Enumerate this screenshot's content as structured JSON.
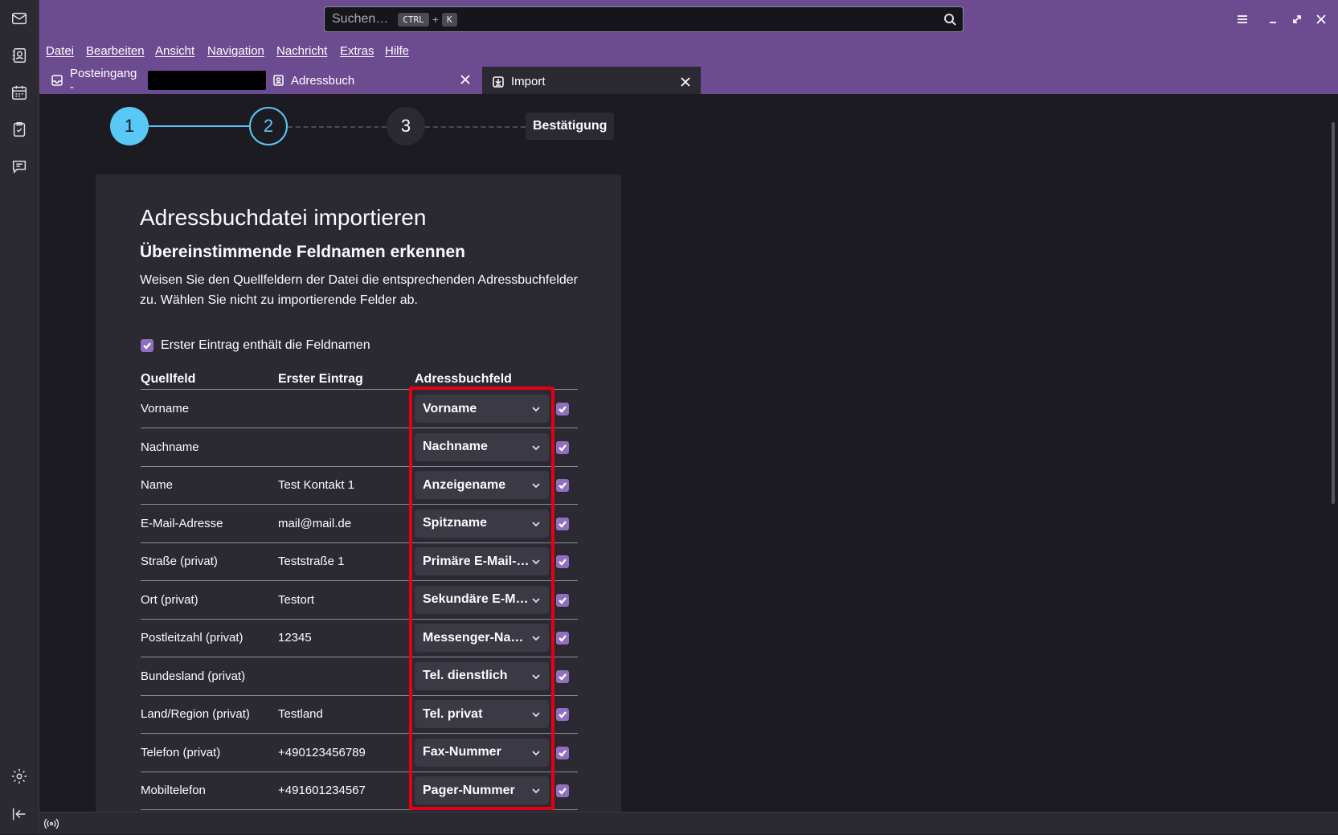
{
  "search": {
    "placeholder": "Suchen…",
    "key1": "CTRL",
    "plus": "+",
    "key2": "K"
  },
  "menu": [
    "Datei",
    "Bearbeiten",
    "Ansicht",
    "Navigation",
    "Nachricht",
    "Extras",
    "Hilfe"
  ],
  "tabs": [
    {
      "label": "Posteingang -"
    },
    {
      "label": "Adressbuch"
    },
    {
      "label": "Import"
    }
  ],
  "stepper": {
    "step1": "1",
    "step2": "2",
    "step3": "3",
    "confirm": "Bestätigung"
  },
  "page": {
    "title": "Adressbuchdatei importieren",
    "subtitle": "Übereinstimmende Feldnamen erkennen",
    "description": "Weisen Sie den Quellfeldern der Datei die entsprechenden Adressbuchfelder zu. Wählen Sie nicht zu importierende Felder ab.",
    "first_row_label": "Erster Eintrag enthält die Feldnamen"
  },
  "table": {
    "headers": {
      "source": "Quellfeld",
      "first": "Erster Eintrag",
      "target": "Adressbuchfeld"
    },
    "rows": [
      {
        "source": "Vorname",
        "first": "",
        "target": "Vorname"
      },
      {
        "source": "Nachname",
        "first": "",
        "target": "Nachname"
      },
      {
        "source": "Name",
        "first": "Test Kontakt 1",
        "target": "Anzeigename"
      },
      {
        "source": "E-Mail-Adresse",
        "first": "mail@mail.de",
        "target": "Spitzname"
      },
      {
        "source": "Straße (privat)",
        "first": "Teststraße 1",
        "target": "Primäre E-Mail-…"
      },
      {
        "source": "Ort (privat)",
        "first": "Testort",
        "target": "Sekundäre E-M…"
      },
      {
        "source": "Postleitzahl (privat)",
        "first": "12345",
        "target": "Messenger-Na…"
      },
      {
        "source": "Bundesland (privat)",
        "first": "",
        "target": "Tel. dienstlich"
      },
      {
        "source": "Land/Region (privat)",
        "first": "Testland",
        "target": "Tel. privat"
      },
      {
        "source": "Telefon (privat)",
        "first": "+490123456789",
        "target": "Fax-Nummer"
      },
      {
        "source": "Mobiltelefon",
        "first": "+491601234567",
        "target": "Pager-Nummer"
      }
    ]
  },
  "colors": {
    "accent": "#5ac8f5",
    "brand": "#6d4b91",
    "checkbox": "#8f6fbe",
    "highlight": "#e60012"
  }
}
